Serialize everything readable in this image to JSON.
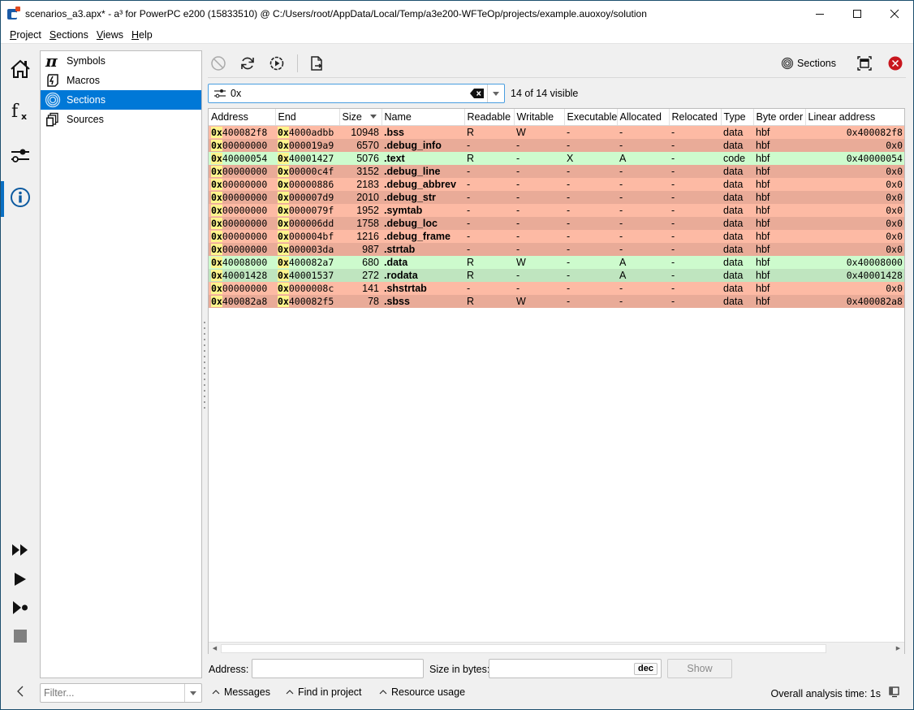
{
  "window": {
    "title": "scenarios_a3.apx* - a³ for PowerPC e200 (15833510) @ C:/Users/root/AppData/Local/Temp/a3e200-WFTeOp/projects/example.auoxoy/solution",
    "minimize_icon": "minimize-icon",
    "maximize_icon": "maximize-icon",
    "close_icon": "close-icon"
  },
  "menubar": {
    "items": [
      {
        "label": "Project",
        "mnemonic": "P",
        "rest": "roject"
      },
      {
        "label": "Sections",
        "mnemonic": "S",
        "rest": "ections"
      },
      {
        "label": "Views",
        "mnemonic": "V",
        "rest": "iews"
      },
      {
        "label": "Help",
        "mnemonic": "H",
        "rest": "elp"
      }
    ]
  },
  "rail": {
    "top": [
      "home-icon",
      "function-icon",
      "settings-sliders-icon",
      "info-icon"
    ],
    "active": "info-icon",
    "bottom": [
      "run-all-icon",
      "run-icon",
      "run-to-icon",
      "stop-icon"
    ],
    "collapse": "‹"
  },
  "views": {
    "items": [
      {
        "label": "Symbols",
        "icon": "pi-icon"
      },
      {
        "label": "Macros",
        "icon": "macro-icon"
      },
      {
        "label": "Sections",
        "icon": "sections-icon",
        "selected": true
      },
      {
        "label": "Sources",
        "icon": "sources-icon"
      }
    ],
    "filter_placeholder": "Filter..."
  },
  "toolbar": {
    "buttons": [
      "cancel-icon",
      "refresh-icon",
      "run-settings-icon",
      "export-icon"
    ],
    "view_label": "Sections",
    "view_icon": "sections-icon"
  },
  "search": {
    "value": "0x",
    "visible_count": "14 of 14 visible"
  },
  "table": {
    "columns": [
      "Address",
      "End",
      "Size",
      "Name",
      "Readable",
      "Writable",
      "Executable",
      "Allocated",
      "Relocated",
      "Type",
      "Byte order",
      "Linear address"
    ],
    "sorted_column": "Size",
    "sort_direction": "descending",
    "rows": [
      {
        "addr_prefix": "0x",
        "addr": "400082f8",
        "end_prefix": "0x",
        "end": "4000adbb",
        "size": "10948",
        "name": ".bss",
        "r": "R",
        "w": "W",
        "x": "-",
        "a": "-",
        "rel": "-",
        "type": "data",
        "order": "hbf",
        "linear": "0x400082f8",
        "color": "red-a"
      },
      {
        "addr_prefix": "0x",
        "addr": "00000000",
        "end_prefix": "0x",
        "end": "000019a9",
        "size": "6570",
        "name": ".debug_info",
        "r": "-",
        "w": "-",
        "x": "-",
        "a": "-",
        "rel": "-",
        "type": "data",
        "order": "hbf",
        "linear": "0x0",
        "color": "red-b"
      },
      {
        "addr_prefix": "0x",
        "addr": "40000054",
        "end_prefix": "0x",
        "end": "40001427",
        "size": "5076",
        "name": ".text",
        "r": "R",
        "w": "-",
        "x": "X",
        "a": "A",
        "rel": "-",
        "type": "code",
        "order": "hbf",
        "linear": "0x40000054",
        "color": "grn-a"
      },
      {
        "addr_prefix": "0x",
        "addr": "00000000",
        "end_prefix": "0x",
        "end": "00000c4f",
        "size": "3152",
        "name": ".debug_line",
        "r": "-",
        "w": "-",
        "x": "-",
        "a": "-",
        "rel": "-",
        "type": "data",
        "order": "hbf",
        "linear": "0x0",
        "color": "red-b"
      },
      {
        "addr_prefix": "0x",
        "addr": "00000000",
        "end_prefix": "0x",
        "end": "00000886",
        "size": "2183",
        "name": ".debug_abbrev",
        "r": "-",
        "w": "-",
        "x": "-",
        "a": "-",
        "rel": "-",
        "type": "data",
        "order": "hbf",
        "linear": "0x0",
        "color": "red-a"
      },
      {
        "addr_prefix": "0x",
        "addr": "00000000",
        "end_prefix": "0x",
        "end": "000007d9",
        "size": "2010",
        "name": ".debug_str",
        "r": "-",
        "w": "-",
        "x": "-",
        "a": "-",
        "rel": "-",
        "type": "data",
        "order": "hbf",
        "linear": "0x0",
        "color": "red-b"
      },
      {
        "addr_prefix": "0x",
        "addr": "00000000",
        "end_prefix": "0x",
        "end": "0000079f",
        "size": "1952",
        "name": ".symtab",
        "r": "-",
        "w": "-",
        "x": "-",
        "a": "-",
        "rel": "-",
        "type": "data",
        "order": "hbf",
        "linear": "0x0",
        "color": "red-a"
      },
      {
        "addr_prefix": "0x",
        "addr": "00000000",
        "end_prefix": "0x",
        "end": "000006dd",
        "size": "1758",
        "name": ".debug_loc",
        "r": "-",
        "w": "-",
        "x": "-",
        "a": "-",
        "rel": "-",
        "type": "data",
        "order": "hbf",
        "linear": "0x0",
        "color": "red-b"
      },
      {
        "addr_prefix": "0x",
        "addr": "00000000",
        "end_prefix": "0x",
        "end": "000004bf",
        "size": "1216",
        "name": ".debug_frame",
        "r": "-",
        "w": "-",
        "x": "-",
        "a": "-",
        "rel": "-",
        "type": "data",
        "order": "hbf",
        "linear": "0x0",
        "color": "red-a"
      },
      {
        "addr_prefix": "0x",
        "addr": "00000000",
        "end_prefix": "0x",
        "end": "000003da",
        "size": "987",
        "name": ".strtab",
        "r": "-",
        "w": "-",
        "x": "-",
        "a": "-",
        "rel": "-",
        "type": "data",
        "order": "hbf",
        "linear": "0x0",
        "color": "red-b"
      },
      {
        "addr_prefix": "0x",
        "addr": "40008000",
        "end_prefix": "0x",
        "end": "400082a7",
        "size": "680",
        "name": ".data",
        "r": "R",
        "w": "W",
        "x": "-",
        "a": "A",
        "rel": "-",
        "type": "data",
        "order": "hbf",
        "linear": "0x40008000",
        "color": "grn-a"
      },
      {
        "addr_prefix": "0x",
        "addr": "40001428",
        "end_prefix": "0x",
        "end": "40001537",
        "size": "272",
        "name": ".rodata",
        "r": "R",
        "w": "-",
        "x": "-",
        "a": "A",
        "rel": "-",
        "type": "data",
        "order": "hbf",
        "linear": "0x40001428",
        "color": "grn-b"
      },
      {
        "addr_prefix": "0x",
        "addr": "00000000",
        "end_prefix": "0x",
        "end": "0000008c",
        "size": "141",
        "name": ".shstrtab",
        "r": "-",
        "w": "-",
        "x": "-",
        "a": "-",
        "rel": "-",
        "type": "data",
        "order": "hbf",
        "linear": "0x0",
        "color": "red-a"
      },
      {
        "addr_prefix": "0x",
        "addr": "400082a8",
        "end_prefix": "0x",
        "end": "400082f5",
        "size": "78",
        "name": ".sbss",
        "r": "R",
        "w": "W",
        "x": "-",
        "a": "-",
        "rel": "-",
        "type": "data",
        "order": "hbf",
        "linear": "0x400082a8",
        "color": "red-b"
      }
    ]
  },
  "address_form": {
    "address_label": "Address:",
    "address_value": "",
    "size_label": "Size in bytes:",
    "size_value": "",
    "dec_label": "dec",
    "show_label": "Show"
  },
  "statusbar": {
    "tabs": [
      "Messages",
      "Find in project",
      "Resource usage"
    ],
    "analysis_time": "Overall analysis time: 1s"
  },
  "colors": {
    "selection": "#0078d7",
    "row_red_light": "#fdbaa4",
    "row_red_dark": "#e9ab98",
    "row_green_light": "#cdfbcd",
    "row_green_dark": "#bfe5bf",
    "match_highlight": "#fdf48c",
    "close_red": "#c8161d"
  }
}
